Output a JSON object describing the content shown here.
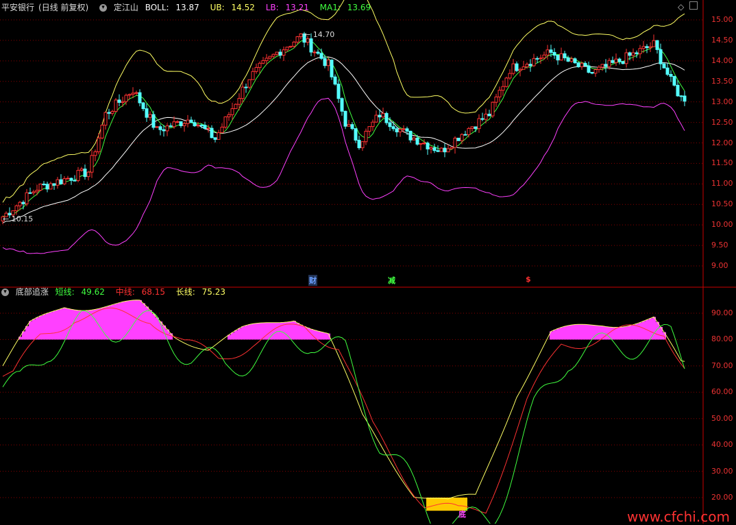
{
  "main_panel": {
    "stock_name": "平安银行",
    "period": "(日线 前复权)",
    "indicator_name": "定江山",
    "boll_label": "BOLL:",
    "boll_value": "13.87",
    "ub_label": "UB:",
    "ub_value": "14.52",
    "lb_label": "LB:",
    "lb_value": "13.21",
    "ma1_label": "MA1:",
    "ma1_value": "13.69",
    "high_annotation": "14.70",
    "low_annotation": "10.15",
    "event_marks": [
      "财",
      "减",
      "$"
    ],
    "price_axis": [
      "15.00",
      "14.50",
      "14.00",
      "13.50",
      "13.00",
      "12.50",
      "12.00",
      "11.50",
      "11.00",
      "10.50",
      "10.00",
      "9.50",
      "9.00"
    ]
  },
  "sub_panel": {
    "indicator_name": "底部追涨",
    "short_label": "短线:",
    "short_value": "49.62",
    "mid_label": "中线:",
    "mid_value": "68.15",
    "long_label": "长线:",
    "long_value": "75.23",
    "bottom_mark": "底",
    "axis": [
      "90.00",
      "80.00",
      "70.00",
      "60.00",
      "50.00",
      "40.00",
      "30.00",
      "20.00"
    ]
  },
  "watermark": "www.cfchi.com",
  "colors": {
    "up": "#ff3232",
    "down": "#54ffff",
    "ub": "#ffff64",
    "lb": "#ff40ff",
    "boll": "#ffffff",
    "ma": "#40ff40",
    "grid": "#8b0000",
    "short": "#40ff40",
    "mid": "#ff3232",
    "long": "#ffff64",
    "hist": "#ff40ff",
    "bottom_fill": "#ffc800"
  }
}
